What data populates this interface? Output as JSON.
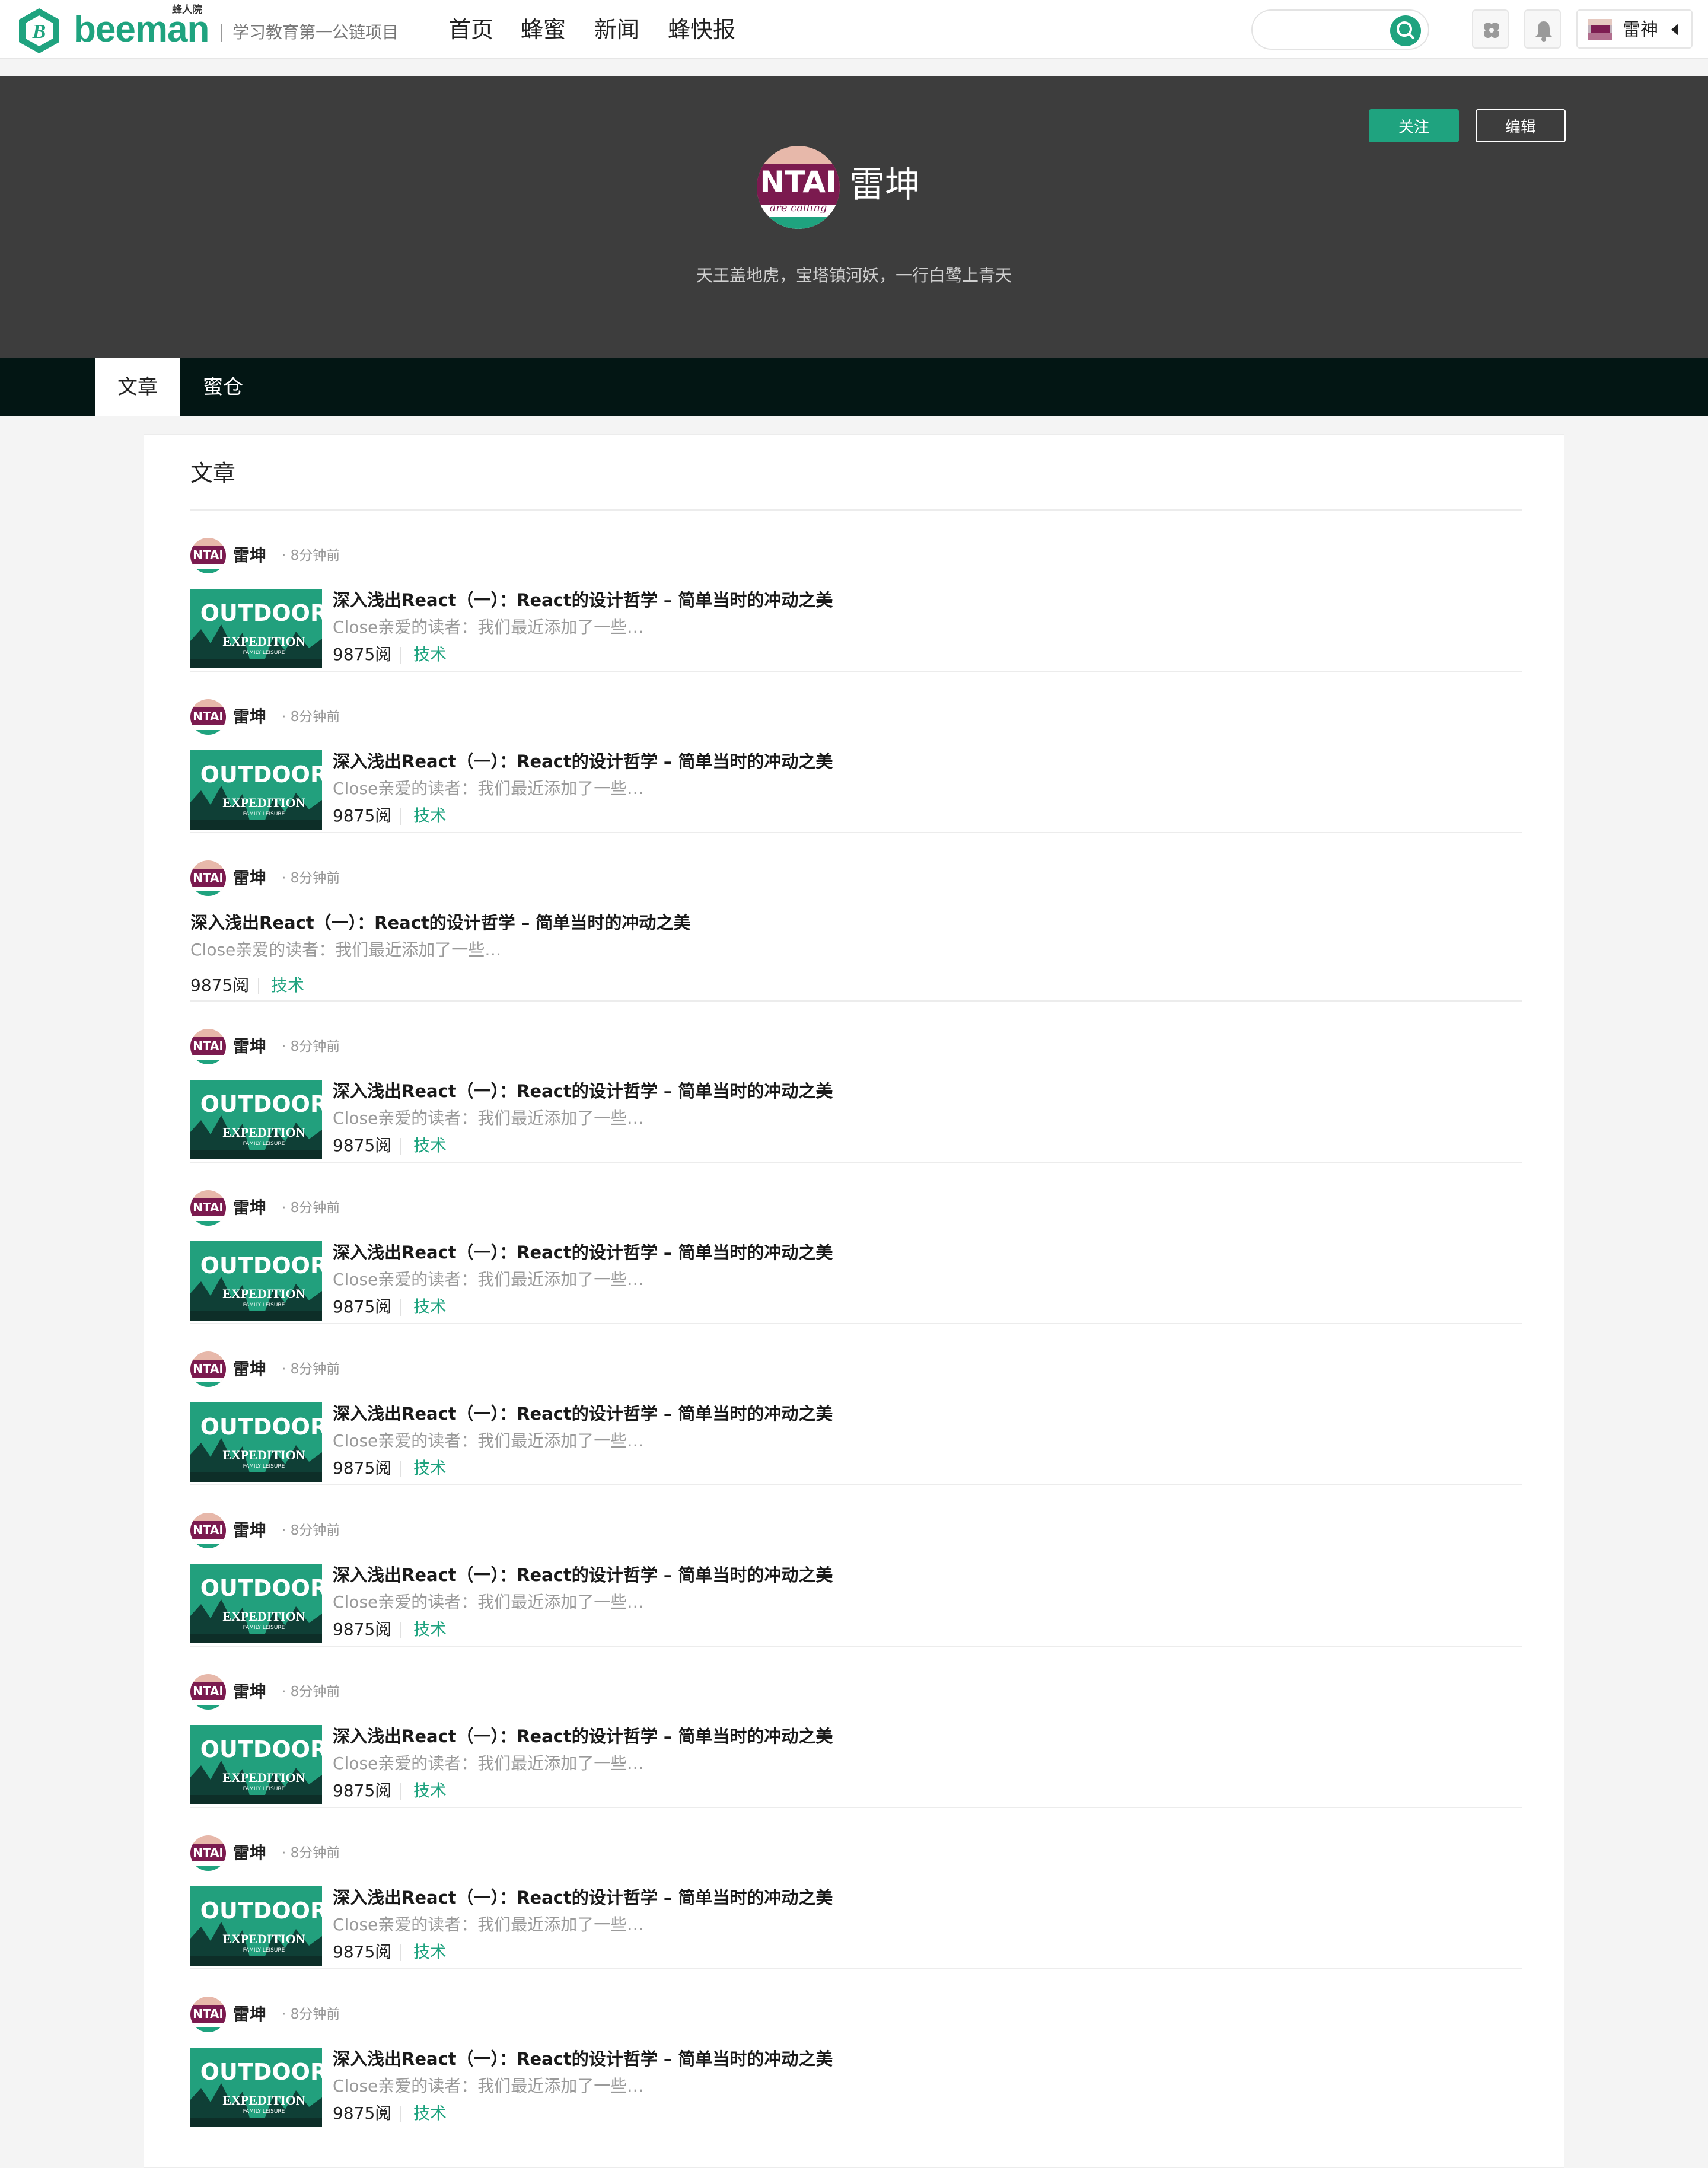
{
  "header": {
    "logo_small": "蜂人院",
    "logo_word": "beeman",
    "slogan": "学习教育第一公链项目",
    "nav": [
      "首页",
      "蜂蜜",
      "新闻",
      "蜂快报"
    ],
    "search_placeholder": "",
    "user_name": "雷神"
  },
  "profile": {
    "name": "雷坤",
    "bio": "天王盖地虎，宝塔镇河妖，一行白鹭上青天",
    "follow_label": "关注",
    "edit_label": "编辑",
    "avatar_text_top": "NTAI",
    "avatar_text_script": "are calling"
  },
  "tabs": [
    "文章",
    "蜜仓"
  ],
  "articles_section": {
    "title": "文章",
    "thumb_text": {
      "big": "OUTDOOR",
      "mid": "EXPEDITION",
      "small": "FAMILY LEISURE"
    },
    "items": [
      {
        "author": "雷坤",
        "time": "· 8分钟前",
        "title": "深入浅出React（一）：React的设计哲学 – 简单当时的冲动之美",
        "excerpt": "Close亲爱的读者：我们最近添加了一些…",
        "reads": "9875阅",
        "tag": "技术",
        "has_thumb": true
      },
      {
        "author": "雷坤",
        "time": "· 8分钟前",
        "title": "深入浅出React（一）：React的设计哲学 – 简单当时的冲动之美",
        "excerpt": "Close亲爱的读者：我们最近添加了一些…",
        "reads": "9875阅",
        "tag": "技术",
        "has_thumb": true
      },
      {
        "author": "雷坤",
        "time": "· 8分钟前",
        "title": "深入浅出React（一）：React的设计哲学 – 简单当时的冲动之美",
        "excerpt": "Close亲爱的读者：我们最近添加了一些…",
        "reads": "9875阅",
        "tag": "技术",
        "has_thumb": false
      },
      {
        "author": "雷坤",
        "time": "· 8分钟前",
        "title": "深入浅出React（一）：React的设计哲学 – 简单当时的冲动之美",
        "excerpt": "Close亲爱的读者：我们最近添加了一些…",
        "reads": "9875阅",
        "tag": "技术",
        "has_thumb": true
      },
      {
        "author": "雷坤",
        "time": "· 8分钟前",
        "title": "深入浅出React（一）：React的设计哲学 – 简单当时的冲动之美",
        "excerpt": "Close亲爱的读者：我们最近添加了一些…",
        "reads": "9875阅",
        "tag": "技术",
        "has_thumb": true
      },
      {
        "author": "雷坤",
        "time": "· 8分钟前",
        "title": "深入浅出React（一）：React的设计哲学 – 简单当时的冲动之美",
        "excerpt": "Close亲爱的读者：我们最近添加了一些…",
        "reads": "9875阅",
        "tag": "技术",
        "has_thumb": true
      },
      {
        "author": "雷坤",
        "time": "· 8分钟前",
        "title": "深入浅出React（一）：React的设计哲学 – 简单当时的冲动之美",
        "excerpt": "Close亲爱的读者：我们最近添加了一些…",
        "reads": "9875阅",
        "tag": "技术",
        "has_thumb": true
      },
      {
        "author": "雷坤",
        "time": "· 8分钟前",
        "title": "深入浅出React（一）：React的设计哲学 – 简单当时的冲动之美",
        "excerpt": "Close亲爱的读者：我们最近添加了一些…",
        "reads": "9875阅",
        "tag": "技术",
        "has_thumb": true
      },
      {
        "author": "雷坤",
        "time": "· 8分钟前",
        "title": "深入浅出React（一）：React的设计哲学 – 简单当时的冲动之美",
        "excerpt": "Close亲爱的读者：我们最近添加了一些…",
        "reads": "9875阅",
        "tag": "技术",
        "has_thumb": true
      },
      {
        "author": "雷坤",
        "time": "· 8分钟前",
        "title": "深入浅出React（一）：React的设计哲学 – 简单当时的冲动之美",
        "excerpt": "Close亲爱的读者：我们最近添加了一些…",
        "reads": "9875阅",
        "tag": "技术",
        "has_thumb": true
      }
    ]
  },
  "colors": {
    "brand_green": "#1fa37f",
    "banner_bg": "#3d3d3d",
    "tabbar_bg": "#031614"
  },
  "icons": [
    "logo-hexagon-icon",
    "search-icon",
    "apps-icon",
    "bell-icon",
    "caret-left-icon"
  ]
}
